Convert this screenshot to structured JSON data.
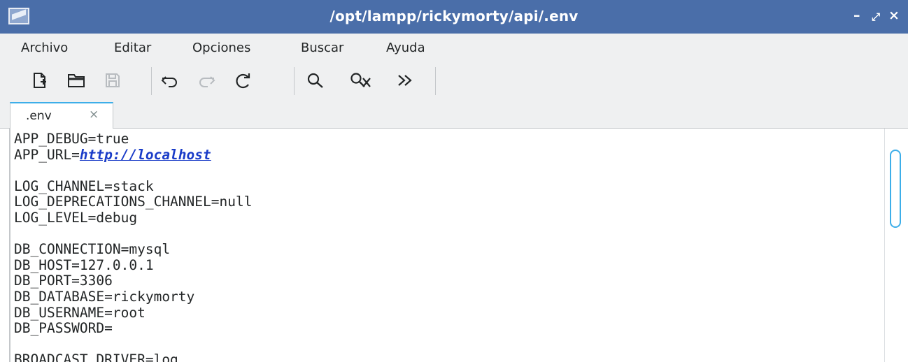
{
  "window": {
    "title": "/opt/lampp/rickymorty/api/.env",
    "controls": {
      "minimize": "–",
      "maximize": "⤢",
      "close": "×"
    }
  },
  "menu": [
    "Archivo",
    "Editar",
    "Opciones",
    "Buscar",
    "Ayuda"
  ],
  "toolbar": {
    "new_icon": "new-file-icon",
    "open_icon": "open-folder-icon",
    "save_icon": "save-icon",
    "undo_icon": "undo-icon",
    "redo_icon": "redo-icon",
    "reload_icon": "reload-icon",
    "find_icon": "search-icon",
    "replace_icon": "find-replace-icon",
    "more_icon": "chevron-double-right-icon"
  },
  "tab": {
    "label": ".env",
    "close": "×"
  },
  "editor": {
    "lines": [
      {
        "text": "APP_DEBUG=true"
      },
      {
        "prefix": "APP_URL=",
        "link": "http://localhost"
      },
      {
        "text": ""
      },
      {
        "text": "LOG_CHANNEL=stack"
      },
      {
        "text": "LOG_DEPRECATIONS_CHANNEL=null"
      },
      {
        "text": "LOG_LEVEL=debug"
      },
      {
        "text": ""
      },
      {
        "text": "DB_CONNECTION=mysql"
      },
      {
        "text": "DB_HOST=127.0.0.1"
      },
      {
        "text": "DB_PORT=3306"
      },
      {
        "text": "DB_DATABASE=rickymorty"
      },
      {
        "text": "DB_USERNAME=root"
      },
      {
        "text": "DB_PASSWORD="
      },
      {
        "text": ""
      },
      {
        "text": "BROADCAST_DRIVER=log"
      }
    ]
  },
  "colors": {
    "titlebar": "#4a6ea9",
    "accent": "#3daee9",
    "link": "#1a3cc8",
    "chrome": "#eff0f1"
  }
}
